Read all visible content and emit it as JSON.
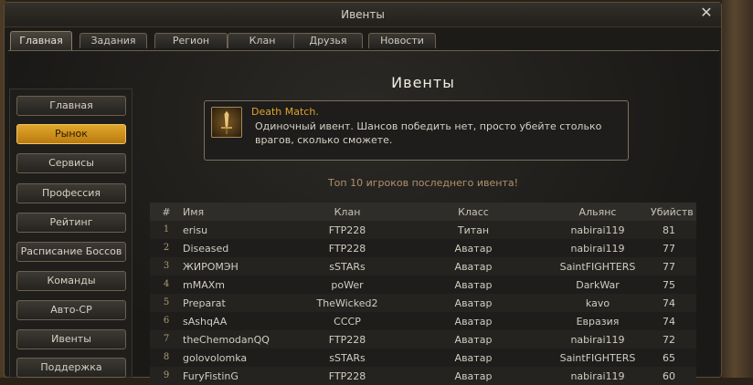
{
  "window": {
    "title": "Ивенты",
    "close_icon": "close-icon"
  },
  "tabs": [
    {
      "label": "Главная",
      "active": true
    },
    {
      "label": "Задания",
      "active": false
    },
    {
      "label": "Регион",
      "active": false
    },
    {
      "label": "Клан",
      "active": false
    },
    {
      "label": "Друзья",
      "active": false
    },
    {
      "label": "Новости",
      "active": false
    }
  ],
  "sidebar": {
    "items": [
      {
        "label": "Главная",
        "active": false
      },
      {
        "label": "Рынок",
        "active": true
      },
      {
        "label": "Сервисы",
        "active": false
      },
      {
        "label": "Профессия",
        "active": false
      },
      {
        "label": "Рейтинг",
        "active": false
      },
      {
        "label": "Расписание Боссов",
        "active": false
      },
      {
        "label": "Команды",
        "active": false
      },
      {
        "label": "Авто-CP",
        "active": false
      },
      {
        "label": "Ивенты",
        "active": false
      },
      {
        "label": "Поддержка",
        "active": false
      }
    ]
  },
  "main": {
    "heading": "Ивенты",
    "event": {
      "icon": "sword-icon",
      "title": "Death Match.",
      "description": "Одиночный ивент. Шансов победить нет, просто убейте столько врагов, сколько сможете."
    },
    "top_caption": "Топ 10 игроков последнего ивента!",
    "table": {
      "headers": {
        "num": "#",
        "name": "Имя",
        "clan": "Клан",
        "class": "Класс",
        "alliance": "Альянс",
        "kills": "Убийств"
      },
      "rows": [
        {
          "num": "1",
          "name": "erisu",
          "clan": "FTP228",
          "class": "Титан",
          "alliance": "nabirai119",
          "kills": "81"
        },
        {
          "num": "2",
          "name": "Diseased",
          "clan": "FTP228",
          "class": "Аватар",
          "alliance": "nabirai119",
          "kills": "77"
        },
        {
          "num": "3",
          "name": "ЖИРОМЭН",
          "clan": "sSTARs",
          "class": "Аватар",
          "alliance": "SaintFIGHTERS",
          "kills": "77"
        },
        {
          "num": "4",
          "name": "mMAXm",
          "clan": "poWer",
          "class": "Аватар",
          "alliance": "DarkWar",
          "kills": "75"
        },
        {
          "num": "5",
          "name": "Preparat",
          "clan": "TheWicked2",
          "class": "Аватар",
          "alliance": "kavo",
          "kills": "74"
        },
        {
          "num": "6",
          "name": "sAshqAA",
          "clan": "CCCP",
          "class": "Аватар",
          "alliance": "Евразия",
          "kills": "74"
        },
        {
          "num": "7",
          "name": "theChemodanQQ",
          "clan": "FTP228",
          "class": "Аватар",
          "alliance": "nabirai119",
          "kills": "72"
        },
        {
          "num": "8",
          "name": "golovolomka",
          "clan": "sSTARs",
          "class": "Аватар",
          "alliance": "SaintFIGHTERS",
          "kills": "65"
        },
        {
          "num": "9",
          "name": "FuryFistinG",
          "clan": "FTP228",
          "class": "Аватар",
          "alliance": "nabirai119",
          "kills": "60"
        }
      ]
    }
  },
  "colors": {
    "accent": "#e0a72a",
    "event_title": "#e0a32a",
    "caption": "#b1916b"
  }
}
